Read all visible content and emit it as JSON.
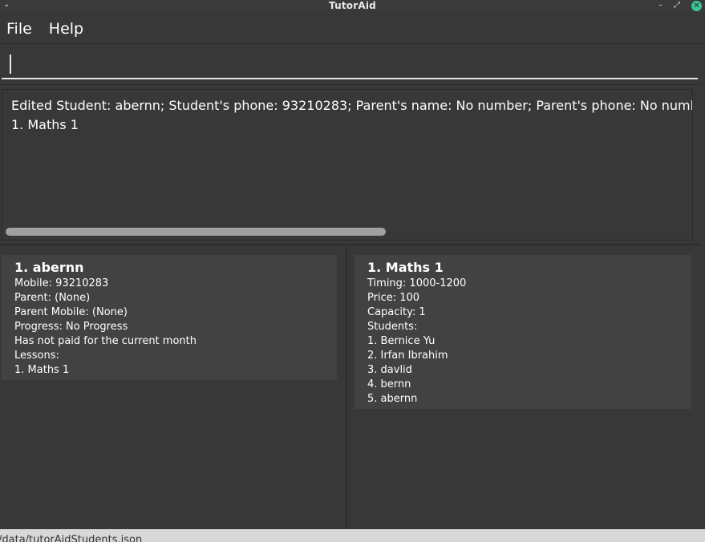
{
  "window": {
    "title": "TutorAid"
  },
  "menu": {
    "items": [
      "File",
      "Help"
    ]
  },
  "command_box": {
    "value": ""
  },
  "result_display": {
    "line1": "Edited Student: abernn; Student's phone: 93210283; Parent's name: No number; Parent's phone: No number;",
    "line2": "1.  Maths 1"
  },
  "student_card": {
    "title": "1.  abernn",
    "mobile": "Mobile: 93210283",
    "parent": "Parent: (None)",
    "parent_mobile": "Parent Mobile: (None)",
    "progress": "Progress: No Progress",
    "payment": "Has not paid for the current month",
    "lessons_header": "Lessons:",
    "lessons": [
      "1.  Maths 1"
    ]
  },
  "lesson_card": {
    "title": "1.  Maths 1",
    "timing": "Timing: 1000-1200",
    "price": "Price: 100",
    "capacity": "Capacity: 1",
    "students_header": "Students:",
    "students": [
      "1.  Bernice Yu",
      "2.  Irfan Ibrahim",
      "3.  davlid",
      "4.  bernn",
      "5.  abernn"
    ]
  },
  "status_bar": {
    "path": "/data/tutorAidStudents.json"
  }
}
